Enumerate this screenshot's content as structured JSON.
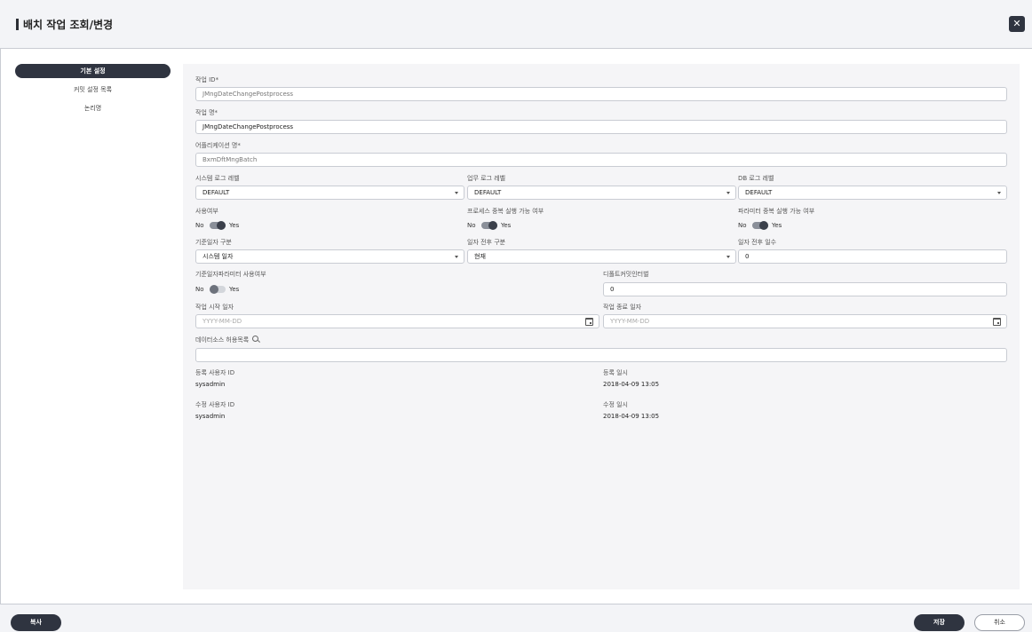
{
  "header": {
    "title": "배치 작업 조회/변경",
    "close_icon": "close-icon"
  },
  "sidenav": {
    "items": [
      {
        "label": "기본 설정"
      },
      {
        "label": "커밋 설정 목록"
      },
      {
        "label": "논리명"
      }
    ]
  },
  "form": {
    "job_id": {
      "label": "작업 ID",
      "req": "*",
      "value": "JMngDateChangePostprocess"
    },
    "job_name": {
      "label": "작업 명",
      "req": "*",
      "value": "JMngDateChangePostprocess"
    },
    "app_name": {
      "label": "어플리케이션 명",
      "req": "*",
      "value": "BxmDftMngBatch"
    },
    "sys_log": {
      "label": "시스템 로그 레벨",
      "value": "DEFAULT"
    },
    "biz_log": {
      "label": "업무 로그 레벨",
      "value": "DEFAULT"
    },
    "db_log": {
      "label": "DB 로그 레벨",
      "value": "DEFAULT"
    },
    "use_yn": {
      "label": "사용여부",
      "off": "No",
      "on": "Yes",
      "state": true
    },
    "proc_dup": {
      "label": "프로세스 중복 실행 가능 여부",
      "off": "No",
      "on": "Yes",
      "state": true
    },
    "param_dup": {
      "label": "파라미터 중복 실행 가능 여부",
      "off": "No",
      "on": "Yes",
      "state": true
    },
    "base_date_type": {
      "label": "기준일자 구분",
      "value": "시스템 일자"
    },
    "date_rel": {
      "label": "일자 전후 구분",
      "value": "현재"
    },
    "date_days": {
      "label": "일자 전후 일수",
      "value": "0"
    },
    "base_date_param": {
      "label": "기준일자파라미터 사용여부",
      "off": "No",
      "on": "Yes",
      "state": false
    },
    "default_commit": {
      "label": "디폴트커밋인터벌",
      "value": "0"
    },
    "start_date": {
      "label": "작업 시작 일자",
      "placeholder": "YYYY-MM-DD"
    },
    "end_date": {
      "label": "작업 종료 일자",
      "placeholder": "YYYY-MM-DD"
    },
    "datasource": {
      "label": "데이터소스 허용목록",
      "value": ""
    },
    "reg_user": {
      "label": "등록 사용자 ID",
      "value": "sysadmin"
    },
    "reg_date": {
      "label": "등록 일시",
      "value": "2018-04-09 13:05"
    },
    "mod_user": {
      "label": "수정 사용자 ID",
      "value": "sysadmin"
    },
    "mod_date": {
      "label": "수정 일시",
      "value": "2018-04-09 13:05"
    }
  },
  "footer": {
    "copy": "복사",
    "save": "저장",
    "cancel": "취소"
  }
}
